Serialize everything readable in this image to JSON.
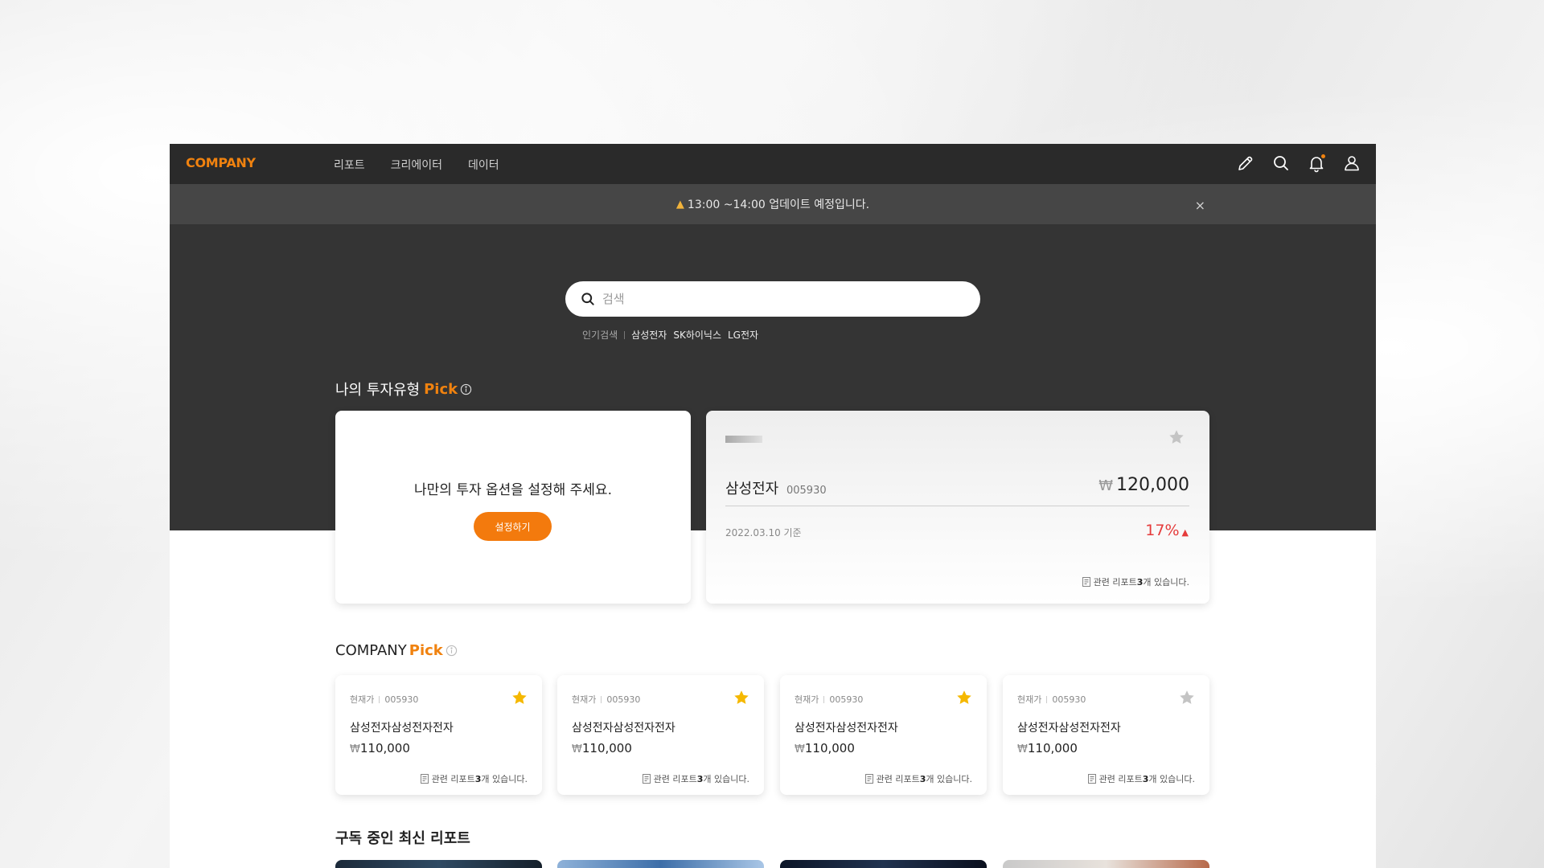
{
  "brand": {
    "logo": "COMPANY",
    "accent_color": "#f0820f"
  },
  "nav": {
    "menu": [
      "리포트",
      "크리에이터",
      "데이터"
    ],
    "icons": [
      "pencil-icon",
      "search-icon",
      "bell-icon",
      "user-icon"
    ]
  },
  "notice": {
    "icon": "bell-emoji",
    "text": "13:00 ~14:00 업데이트 예정입니다.",
    "close": "×"
  },
  "search": {
    "placeholder": "검색",
    "popular_label": "인기검색",
    "popular_items": [
      "삼성전자",
      "SK하이닉스",
      "LG전자"
    ]
  },
  "my_pick": {
    "title": "나의 투자유형",
    "accent": "Pick",
    "setup": {
      "text": "나만의 투자 옵션을 설정해 주세요.",
      "button": "설정하기"
    },
    "stock": {
      "name": "삼성전자",
      "code": "005930",
      "currency": "₩",
      "price": "120,000",
      "date": "2022.03.10 기준",
      "change": "17%",
      "change_direction": "▲",
      "change_color": "#e53b3b",
      "reports_prefix": "관련 리포트 ",
      "reports_count": "3",
      "reports_suffix": "개 있습니다."
    }
  },
  "company_pick": {
    "title": "COMPANY",
    "accent": "Pick",
    "cards": [
      {
        "label": "현재가",
        "code": "005930",
        "name": "삼성전자삼성전자전자",
        "currency": "₩",
        "price": "110,000",
        "reports_prefix": "관련 리포트 ",
        "reports_count": "3",
        "reports_suffix": "개 있습니다.",
        "starred": true
      },
      {
        "label": "현재가",
        "code": "005930",
        "name": "삼성전자삼성전자전자",
        "currency": "₩",
        "price": "110,000",
        "reports_prefix": "관련 리포트 ",
        "reports_count": "3",
        "reports_suffix": "개 있습니다.",
        "starred": true
      },
      {
        "label": "현재가",
        "code": "005930",
        "name": "삼성전자삼성전자전자",
        "currency": "₩",
        "price": "110,000",
        "reports_prefix": "관련 리포트 ",
        "reports_count": "3",
        "reports_suffix": "개 있습니다.",
        "starred": true
      },
      {
        "label": "현재가",
        "code": "005930",
        "name": "삼성전자삼성전자전자",
        "currency": "₩",
        "price": "110,000",
        "reports_prefix": "관련 리포트 ",
        "reports_count": "3",
        "reports_suffix": "개 있습니다.",
        "starred": false
      }
    ],
    "star_on_color": "#f5b800",
    "star_off_color": "#c4c4c4"
  },
  "subscribed": {
    "title": "구독 중인 최신 리포트"
  }
}
